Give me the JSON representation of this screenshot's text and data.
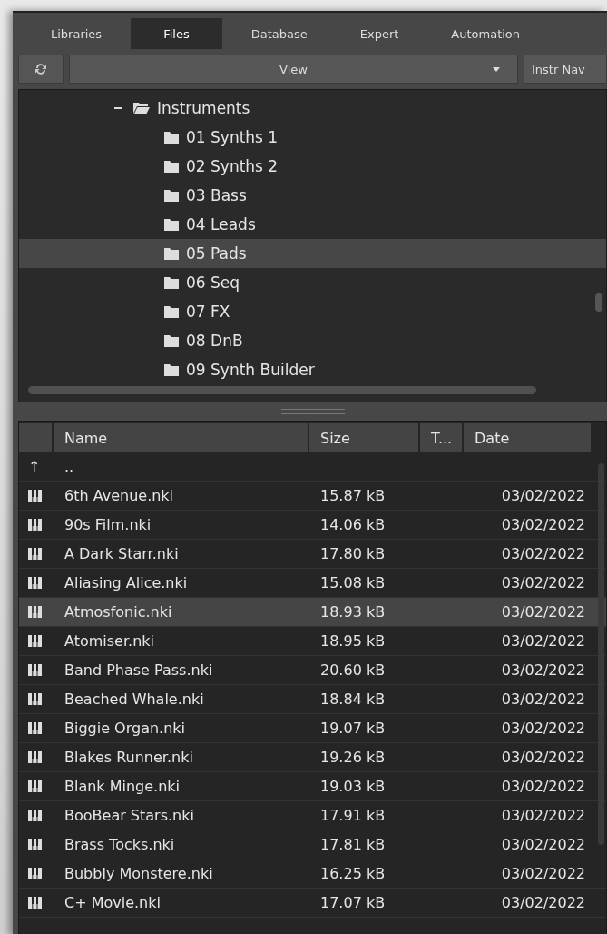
{
  "tabs": [
    {
      "label": "Libraries",
      "selected": false
    },
    {
      "label": "Files",
      "selected": true
    },
    {
      "label": "Database",
      "selected": false
    },
    {
      "label": "Expert",
      "selected": false
    },
    {
      "label": "Automation",
      "selected": false
    }
  ],
  "toolbar": {
    "view_label": "View",
    "nav_button": "Instr Nav"
  },
  "tree": {
    "items": [
      {
        "label": "Instruments",
        "expanded": true,
        "children": [
          {
            "label": "01 Synths 1",
            "selected": false
          },
          {
            "label": "02 Synths 2",
            "selected": false
          },
          {
            "label": "03 Bass",
            "selected": false
          },
          {
            "label": "04 Leads",
            "selected": false
          },
          {
            "label": "05 Pads",
            "selected": true
          },
          {
            "label": "06 Seq",
            "selected": false
          },
          {
            "label": "07 FX",
            "selected": false
          },
          {
            "label": "08 DnB",
            "selected": false
          },
          {
            "label": "09 Synth Builder",
            "selected": false
          }
        ]
      }
    ]
  },
  "table": {
    "columns": [
      "Name",
      "Size",
      "T...",
      "Date"
    ],
    "rows": [
      {
        "kind": "parent",
        "icon": "↑",
        "name": "..",
        "selected": false
      },
      {
        "kind": "instrument",
        "name": "6th Avenue.nki",
        "size": "15.87 kB",
        "date": "03/02/2022",
        "selected": false
      },
      {
        "kind": "instrument",
        "name": "90s Film.nki",
        "size": "14.06 kB",
        "date": "03/02/2022",
        "selected": false
      },
      {
        "kind": "instrument",
        "name": "A Dark Starr.nki",
        "size": "17.80 kB",
        "date": "03/02/2022",
        "selected": false
      },
      {
        "kind": "instrument",
        "name": "Aliasing Alice.nki",
        "size": "15.08 kB",
        "date": "03/02/2022",
        "selected": false
      },
      {
        "kind": "instrument",
        "name": "Atmosfonic.nki",
        "size": "18.93 kB",
        "date": "03/02/2022",
        "selected": true
      },
      {
        "kind": "instrument",
        "name": "Atomiser.nki",
        "size": "18.95 kB",
        "date": "03/02/2022",
        "selected": false
      },
      {
        "kind": "instrument",
        "name": "Band Phase Pass.nki",
        "size": "20.60 kB",
        "date": "03/02/2022",
        "selected": false
      },
      {
        "kind": "instrument",
        "name": "Beached Whale.nki",
        "size": "18.84 kB",
        "date": "03/02/2022",
        "selected": false
      },
      {
        "kind": "instrument",
        "name": "Biggie Organ.nki",
        "size": "19.07 kB",
        "date": "03/02/2022",
        "selected": false
      },
      {
        "kind": "instrument",
        "name": "Blakes Runner.nki",
        "size": "19.26 kB",
        "date": "03/02/2022",
        "selected": false
      },
      {
        "kind": "instrument",
        "name": "Blank Minge.nki",
        "size": "19.03 kB",
        "date": "03/02/2022",
        "selected": false
      },
      {
        "kind": "instrument",
        "name": "BooBear Stars.nki",
        "size": "17.91 kB",
        "date": "03/02/2022",
        "selected": false
      },
      {
        "kind": "instrument",
        "name": "Brass Tocks.nki",
        "size": "17.81 kB",
        "date": "03/02/2022",
        "selected": false
      },
      {
        "kind": "instrument",
        "name": "Bubbly Monstere.nki",
        "size": "16.25 kB",
        "date": "03/02/2022",
        "selected": false
      },
      {
        "kind": "instrument",
        "name": "C+ Movie.nki",
        "size": "17.07 kB",
        "date": "03/02/2022",
        "selected": false
      }
    ]
  }
}
